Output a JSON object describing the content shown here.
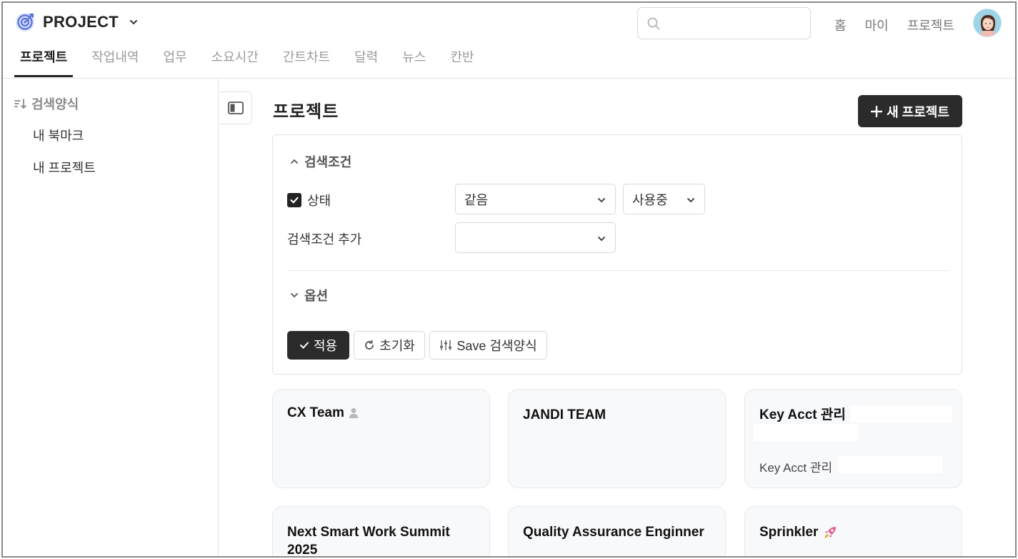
{
  "app": {
    "brand": "PROJECT"
  },
  "search": {
    "placeholder": ""
  },
  "top_links": [
    "홈",
    "마이",
    "프로젝트"
  ],
  "tabs": [
    "프로젝트",
    "작업내역",
    "업무",
    "소요시간",
    "간트차트",
    "달력",
    "뉴스",
    "칸반"
  ],
  "sidebar": {
    "header": "검색양식",
    "items": [
      "내 북마크",
      "내 프로젝트"
    ]
  },
  "main": {
    "title": "프로젝트",
    "new_button": "새 프로젝트"
  },
  "filter": {
    "section_title": "검색조건",
    "status_label": "상태",
    "status_checked": true,
    "operator_value": "같음",
    "status_value": "사용중",
    "add_label": "검색조건 추가",
    "add_value": "",
    "options_title": "옵션",
    "apply_label": "적용",
    "reset_label": "초기화",
    "save_label": "Save 검색양식"
  },
  "cards": [
    {
      "title": "CX Team",
      "desc": "",
      "icon": "user-icon"
    },
    {
      "title": "JANDI TEAM",
      "desc": ""
    },
    {
      "title": "Key Acct 관리",
      "desc": "Key Acct 관리"
    },
    {
      "title": "Next Smart Work Summit 2025",
      "desc": ""
    },
    {
      "title": "Quality Assurance Enginner",
      "desc": ""
    },
    {
      "title": "Sprinkler",
      "desc": "",
      "icon": "rocket-icon"
    }
  ],
  "colors": {
    "primary_dark": "#2b2b2b",
    "accent_blue": "#4f6bd8",
    "border": "#e3e3e3",
    "card_bg": "#f8f9fb"
  }
}
